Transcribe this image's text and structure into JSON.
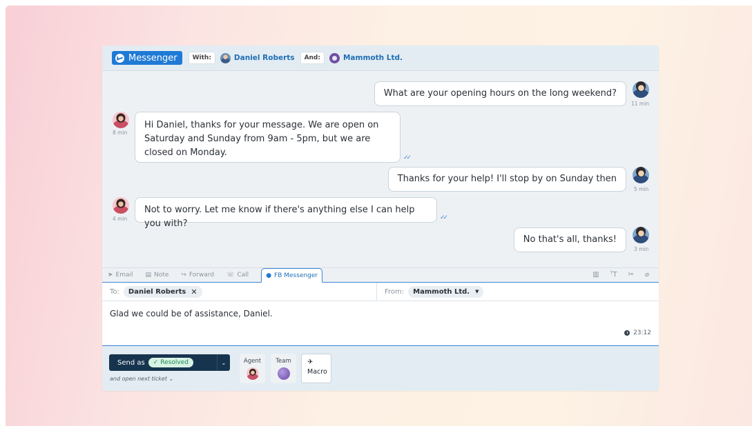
{
  "header": {
    "channel": "Messenger",
    "with_label": "With:",
    "customer_name": "Daniel Roberts",
    "and_label": "And:",
    "company_name": "Mammoth Ltd."
  },
  "messages": [
    {
      "from": "customer",
      "text": "What are your opening hours on the long weekend?",
      "time": "11 min"
    },
    {
      "from": "agent",
      "text": "Hi Daniel, thanks for your message. We are open on Saturday and Sunday from 9am - 5pm, but we are closed on Monday.",
      "time": "8 min"
    },
    {
      "from": "customer",
      "text": "Thanks for your help! I'll stop by on Sunday then",
      "time": "5 min"
    },
    {
      "from": "agent",
      "text": "Not to worry. Let me know if there's anything else I can help you with?",
      "time": "4 min"
    },
    {
      "from": "customer",
      "text": "No that's all, thanks!",
      "time": "3 min"
    }
  ],
  "tabs": [
    {
      "label": "Email",
      "icon": "send-icon"
    },
    {
      "label": "Note",
      "icon": "note-icon"
    },
    {
      "label": "Forward",
      "icon": "forward-icon"
    },
    {
      "label": "Call",
      "icon": "phone-icon"
    },
    {
      "label": "FB Messenger",
      "icon": "messenger-icon",
      "active": true
    }
  ],
  "toolbar_icons": [
    "trash-icon",
    "text-format-icon",
    "scissors-icon",
    "paperclip-icon"
  ],
  "compose": {
    "to_label": "To:",
    "to_value": "Daniel Roberts",
    "from_label": "From:",
    "from_value": "Mammoth Ltd.",
    "draft_text": "Glad we could be of assistance, Daniel.",
    "timer": "23:12"
  },
  "footer": {
    "send_label": "Send as",
    "status": "Resolved",
    "next_ticket": "and open next ticket",
    "agent_label": "Agent",
    "team_label": "Team",
    "macro_label": "Macro"
  },
  "colors": {
    "accent": "#1f7ad6",
    "send_button": "#17344f",
    "resolved_bg": "#d8f3e4",
    "resolved_text": "#1c8a52"
  }
}
